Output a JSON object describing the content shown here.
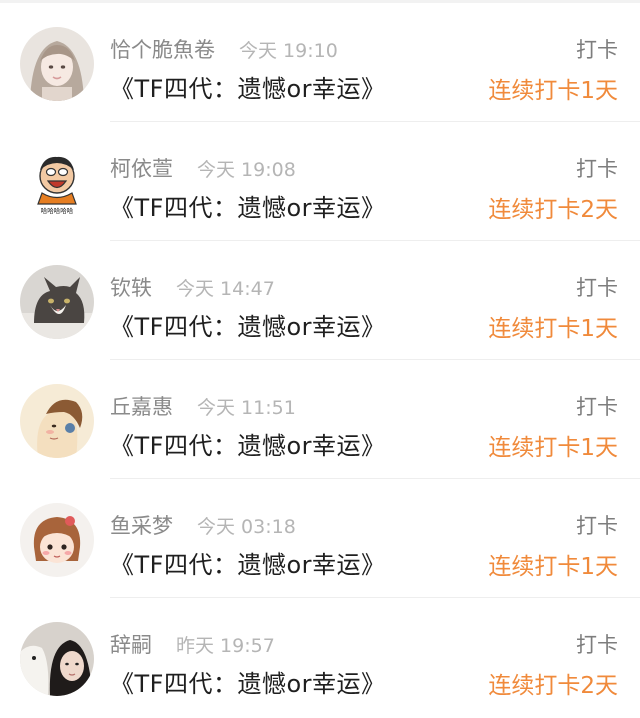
{
  "checkins": [
    {
      "name": "恰个脆魚卷",
      "time": "今天 19:10",
      "title": "《TF四代：遗憾or幸运》",
      "action": "打卡",
      "streak": "连续打卡1天",
      "avatar_icon": "girl-selfie-avatar-icon"
    },
    {
      "name": "柯依萱",
      "time": "今天 19:08",
      "title": "《TF四代：遗憾or幸运》",
      "action": "打卡",
      "streak": "连续打卡2天",
      "avatar_icon": "cartoon-laughing-man-avatar-icon"
    },
    {
      "name": "钦轶",
      "time": "今天 14:47",
      "title": "《TF四代：遗憾or幸运》",
      "action": "打卡",
      "streak": "连续打卡1天",
      "avatar_icon": "cat-photo-avatar-icon"
    },
    {
      "name": "丘嘉惠",
      "time": "今天 11:51",
      "title": "《TF四代：遗憾or幸运》",
      "action": "打卡",
      "streak": "连续打卡1天",
      "avatar_icon": "cartoon-girl-profile-avatar-icon"
    },
    {
      "name": "鱼采梦",
      "time": "今天 03:18",
      "title": "《TF四代：遗憾or幸运》",
      "action": "打卡",
      "streak": "连续打卡1天",
      "avatar_icon": "cartoon-doll-avatar-icon"
    },
    {
      "name": "辞嗣",
      "time": "昨天 19:57",
      "title": "《TF四代：遗憾or幸运》",
      "action": "打卡",
      "streak": "连续打卡2天",
      "avatar_icon": "girl-with-dog-avatar-icon"
    }
  ],
  "colors": {
    "name": "#8a8a8a",
    "time": "#b5b5b5",
    "title": "#1f1f1f",
    "action": "#7d7d7d",
    "streak": "#f08a3b"
  }
}
